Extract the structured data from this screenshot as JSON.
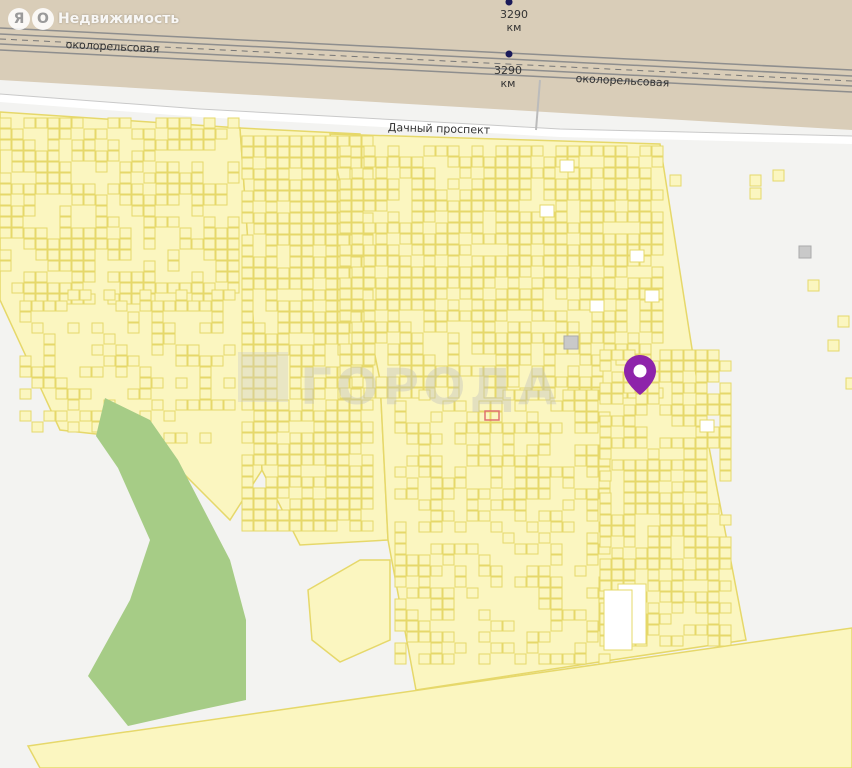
{
  "brand": {
    "logo_letters": [
      "Я",
      "О"
    ],
    "name": "Недвижимость"
  },
  "map": {
    "labels": {
      "km_top": "3290\nкм",
      "km_mid": "3290\nкм",
      "track_left": "околорельсовая",
      "track_right": "околорельсовая",
      "street": "Дачный проспект"
    },
    "watermark": "ГОРОДА",
    "colors": {
      "background": "#f3f3f1",
      "railway_zone": "#d9cdb8",
      "plot_fill": "#fbf6c0",
      "plot_stroke": "#e6d86a",
      "forest": "#a6cc86",
      "marker": "#8e24aa",
      "highlight_plot": "#e07070"
    },
    "marker_icon": "location-pin-icon"
  }
}
